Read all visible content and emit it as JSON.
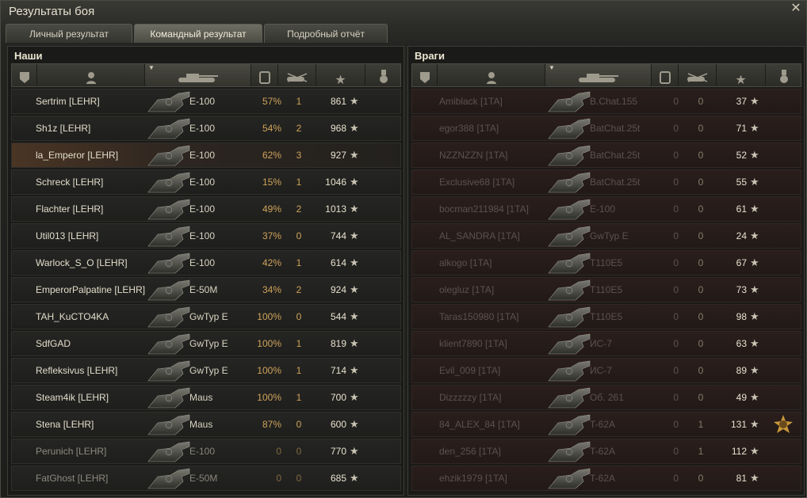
{
  "window": {
    "title": "Результаты боя",
    "close_icon": "close-icon"
  },
  "tabs": [
    {
      "label": "Личный результат",
      "active": false
    },
    {
      "label": "Командный результат",
      "active": true
    },
    {
      "label": "Подробный отчёт",
      "active": false
    }
  ],
  "teams": [
    {
      "title": "Наши",
      "columns": [
        "squad-icon",
        "player-icon",
        "tank-icon",
        "damage-icon",
        "frags-icon",
        "xp-star-icon",
        "medal-icon"
      ],
      "rows": [
        {
          "player": "Sertrim [LEHR]",
          "vehicle": "E-100",
          "value": "57%",
          "frags": "1",
          "xp": "861",
          "highlight": false,
          "dead": false
        },
        {
          "player": "Sh1z [LEHR]",
          "vehicle": "E-100",
          "value": "54%",
          "frags": "2",
          "xp": "968",
          "highlight": false,
          "dead": false
        },
        {
          "player": "la_Emperor [LEHR]",
          "vehicle": "E-100",
          "value": "62%",
          "frags": "3",
          "xp": "927",
          "highlight": true,
          "dead": false
        },
        {
          "player": "Schreck [LEHR]",
          "vehicle": "E-100",
          "value": "15%",
          "frags": "1",
          "xp": "1046",
          "highlight": false,
          "dead": false
        },
        {
          "player": "Flachter [LEHR]",
          "vehicle": "E-100",
          "value": "49%",
          "frags": "2",
          "xp": "1013",
          "highlight": false,
          "dead": false
        },
        {
          "player": "Util013 [LEHR]",
          "vehicle": "E-100",
          "value": "37%",
          "frags": "0",
          "xp": "744",
          "highlight": false,
          "dead": false
        },
        {
          "player": "Warlock_S_O [LEHR]",
          "vehicle": "E-100",
          "value": "42%",
          "frags": "1",
          "xp": "614",
          "highlight": false,
          "dead": false
        },
        {
          "player": "EmperorPalpatine [LEHR]",
          "vehicle": "E-50M",
          "value": "34%",
          "frags": "2",
          "xp": "924",
          "highlight": false,
          "dead": false
        },
        {
          "player": "TAH_KuCTO4KA",
          "vehicle": "GwTyp E",
          "value": "100%",
          "frags": "0",
          "xp": "544",
          "highlight": false,
          "dead": false
        },
        {
          "player": "SdfGAD",
          "vehicle": "GwTyp E",
          "value": "100%",
          "frags": "1",
          "xp": "819",
          "highlight": false,
          "dead": false
        },
        {
          "player": "Refleksivus [LEHR]",
          "vehicle": "GwTyp E",
          "value": "100%",
          "frags": "1",
          "xp": "714",
          "highlight": false,
          "dead": false
        },
        {
          "player": "Steam4ik [LEHR]",
          "vehicle": "Maus",
          "value": "100%",
          "frags": "1",
          "xp": "700",
          "highlight": false,
          "dead": false
        },
        {
          "player": "Stena [LEHR]",
          "vehicle": "Maus",
          "value": "87%",
          "frags": "0",
          "xp": "600",
          "highlight": false,
          "dead": false
        },
        {
          "player": "Perunich [LEHR]",
          "vehicle": "E-100",
          "value": "0",
          "frags": "0",
          "xp": "770",
          "highlight": false,
          "dead": true
        },
        {
          "player": "FatGhost [LEHR]",
          "vehicle": "E-50M",
          "value": "0",
          "frags": "0",
          "xp": "685",
          "highlight": false,
          "dead": true
        }
      ]
    },
    {
      "title": "Враги",
      "columns": [
        "squad-icon",
        "player-icon",
        "tank-icon",
        "damage-icon",
        "frags-icon",
        "xp-star-icon",
        "medal-icon"
      ],
      "rows": [
        {
          "player": "Amiblack [1TA]",
          "vehicle": "B.Chat.155",
          "value": "0",
          "frags": "0",
          "xp": "37",
          "dead": true
        },
        {
          "player": "egor388 [1TA]",
          "vehicle": "BatChat.25t",
          "value": "0",
          "frags": "0",
          "xp": "71",
          "dead": true
        },
        {
          "player": "NZZNZZN [1TA]",
          "vehicle": "BatChat.25t",
          "value": "0",
          "frags": "0",
          "xp": "52",
          "dead": true
        },
        {
          "player": "Exclusive68 [1TA]",
          "vehicle": "BatChat.25t",
          "value": "0",
          "frags": "0",
          "xp": "55",
          "dead": true
        },
        {
          "player": "bocman211984 [1TA]",
          "vehicle": "E-100",
          "value": "0",
          "frags": "0",
          "xp": "61",
          "dead": true
        },
        {
          "player": "AL_SANDRA [1TA]",
          "vehicle": "GwTyp E",
          "value": "0",
          "frags": "0",
          "xp": "24",
          "dead": true
        },
        {
          "player": "alkogo [1TA]",
          "vehicle": "T110E5",
          "value": "0",
          "frags": "0",
          "xp": "67",
          "dead": true
        },
        {
          "player": "olegluz [1TA]",
          "vehicle": "T110E5",
          "value": "0",
          "frags": "0",
          "xp": "73",
          "dead": true
        },
        {
          "player": "Taras150980 [1TA]",
          "vehicle": "T110E5",
          "value": "0",
          "frags": "0",
          "xp": "98",
          "dead": true
        },
        {
          "player": "klient7890 [1TA]",
          "vehicle": "ИС-7",
          "value": "0",
          "frags": "0",
          "xp": "63",
          "dead": true
        },
        {
          "player": "Evil_009 [1TA]",
          "vehicle": "ИС-7",
          "value": "0",
          "frags": "0",
          "xp": "89",
          "dead": true
        },
        {
          "player": "Dizzzzzy [1TA]",
          "vehicle": "Об. 261",
          "value": "0",
          "frags": "0",
          "xp": "49",
          "dead": true
        },
        {
          "player": "84_ALEX_84 [1TA]",
          "vehicle": "T-62A",
          "value": "0",
          "frags": "1",
          "xp": "131",
          "dead": true,
          "medal": "medal-icon"
        },
        {
          "player": "den_256 [1TA]",
          "vehicle": "T-62A",
          "value": "0",
          "frags": "1",
          "xp": "112",
          "dead": true
        },
        {
          "player": "ehzik1979 [1TA]",
          "vehicle": "T-62A",
          "value": "0",
          "frags": "0",
          "xp": "81",
          "dead": true
        }
      ]
    }
  ]
}
